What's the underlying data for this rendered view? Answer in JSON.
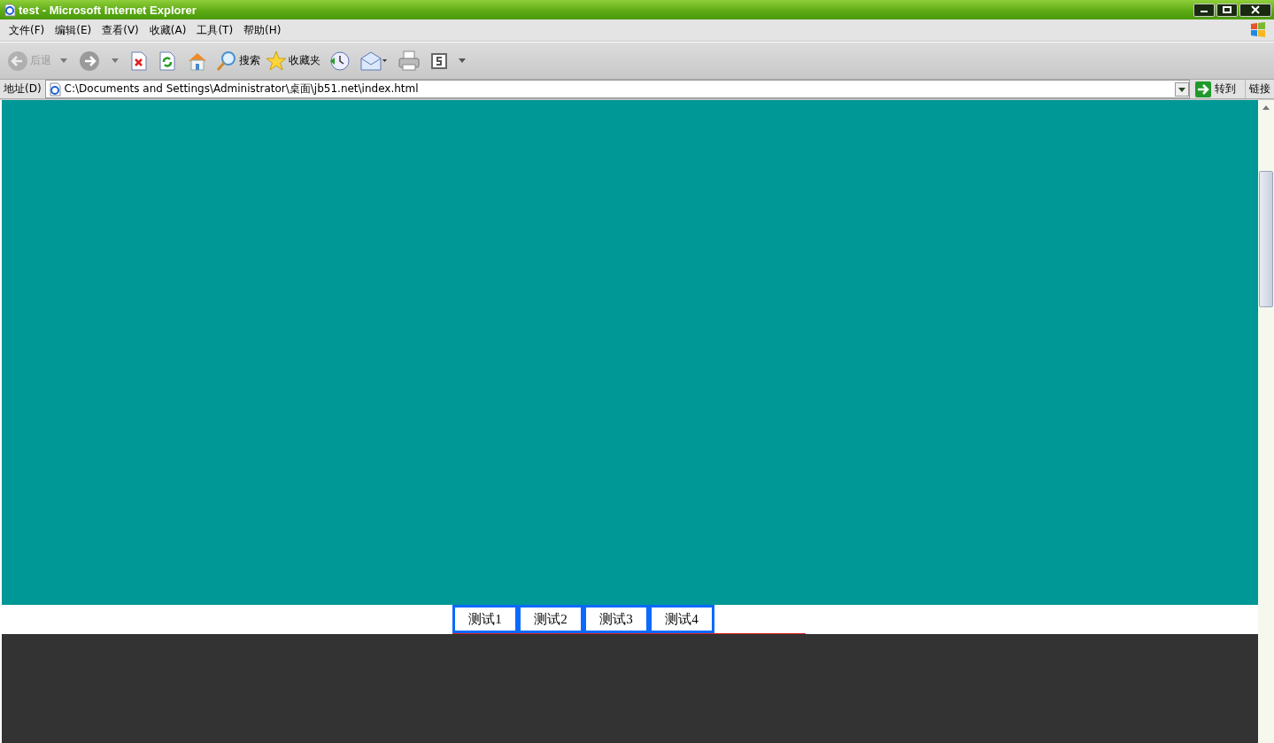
{
  "window": {
    "title": "test - Microsoft Internet Explorer"
  },
  "menu": [
    "文件(F)",
    "编辑(E)",
    "查看(V)",
    "收藏(A)",
    "工具(T)",
    "帮助(H)"
  ],
  "toolbar": {
    "back": {
      "label": "后退",
      "disabled": true
    },
    "search": {
      "label": "搜索"
    },
    "favorites": {
      "label": "收藏夹"
    }
  },
  "address_bar": {
    "label": "地址(D)",
    "value": "C:\\Documents and Settings\\Administrator\\桌面\\jb51.net\\index.html",
    "go": "转到",
    "links": "链接"
  },
  "page": {
    "tabs": [
      {
        "label": "测试1"
      },
      {
        "label": "测试2"
      },
      {
        "label": "测试3"
      },
      {
        "label": "测试4"
      }
    ]
  }
}
